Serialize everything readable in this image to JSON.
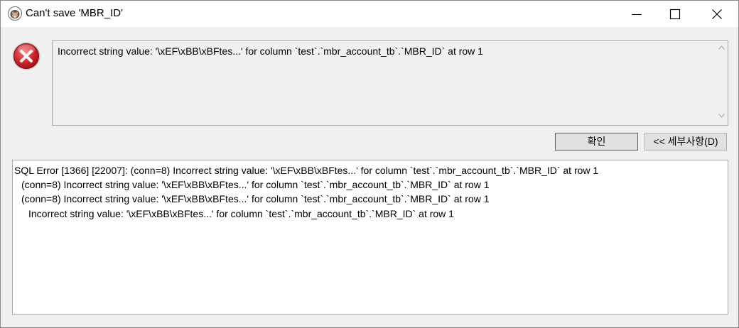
{
  "window": {
    "title": "Can't save 'MBR_ID'"
  },
  "message": {
    "text": "Incorrect string value: '\\xEF\\xBB\\xBFtes...' for column `test`.`mbr_account_tb`.`MBR_ID` at row 1"
  },
  "buttons": {
    "ok_label": "확인",
    "details_label": "<< 세부사항(D)"
  },
  "details": {
    "lines": [
      "SQL Error [1366] [22007]: (conn=8) Incorrect string value: '\\xEF\\xBB\\xBFtes...' for column `test`.`mbr_account_tb`.`MBR_ID` at row 1",
      "(conn=8) Incorrect string value: '\\xEF\\xBB\\xBFtes...' for column `test`.`mbr_account_tb`.`MBR_ID` at row 1",
      "(conn=8) Incorrect string value: '\\xEF\\xBB\\xBFtes...' for column `test`.`mbr_account_tb`.`MBR_ID` at row 1",
      "Incorrect string value: '\\xEF\\xBB\\xBFtes...' for column `test`.`mbr_account_tb`.`MBR_ID` at row 1"
    ]
  },
  "icons": {
    "app": "dbeaver-beaver-icon",
    "error": "error-x-icon",
    "minimize": "minimize-icon",
    "maximize": "maximize-icon",
    "close": "close-icon"
  },
  "colors": {
    "error_red": "#d0242a",
    "focus_border": "#0078d7"
  }
}
